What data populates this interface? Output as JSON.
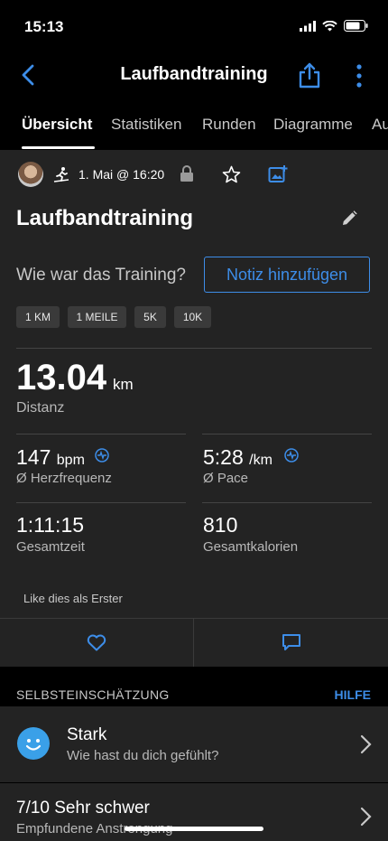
{
  "status": {
    "time": "15:13"
  },
  "nav": {
    "title": "Laufbandtraining"
  },
  "tabs": [
    {
      "label": "Übersicht"
    },
    {
      "label": "Statistiken"
    },
    {
      "label": "Runden"
    },
    {
      "label": "Diagramme"
    },
    {
      "label": "Au"
    }
  ],
  "activity": {
    "date": "1. Mai @ 16:20",
    "title": "Laufbandtraining",
    "question": "Wie war das Training?",
    "note_button": "Notiz hinzufügen",
    "splits": [
      "1 KM",
      "1 MEILE",
      "5K",
      "10K"
    ]
  },
  "stats": {
    "distance": {
      "value": "13.04",
      "unit": "km",
      "label": "Distanz"
    },
    "heart_rate": {
      "value": "147",
      "unit": "bpm",
      "label": "Ø Herzfrequenz"
    },
    "pace": {
      "value": "5:28",
      "unit": "/km",
      "label": "Ø Pace"
    },
    "total_time": {
      "value": "1:11:15",
      "label": "Gesamtzeit"
    },
    "calories": {
      "value": "810",
      "label": "Gesamtkalorien"
    }
  },
  "social": {
    "like_text": "Like dies als Erster"
  },
  "self_eval": {
    "header": "SELBSTEINSCHÄTZUNG",
    "help": "HILFE",
    "feeling": {
      "title": "Stark",
      "subtitle": "Wie hast du dich gefühlt?"
    },
    "effort": {
      "title": "7/10 Sehr schwer",
      "subtitle": "Empfundene Anstrengung"
    }
  },
  "colors": {
    "accent": "#3d8de8",
    "background": "#000000",
    "card": "#232323"
  }
}
